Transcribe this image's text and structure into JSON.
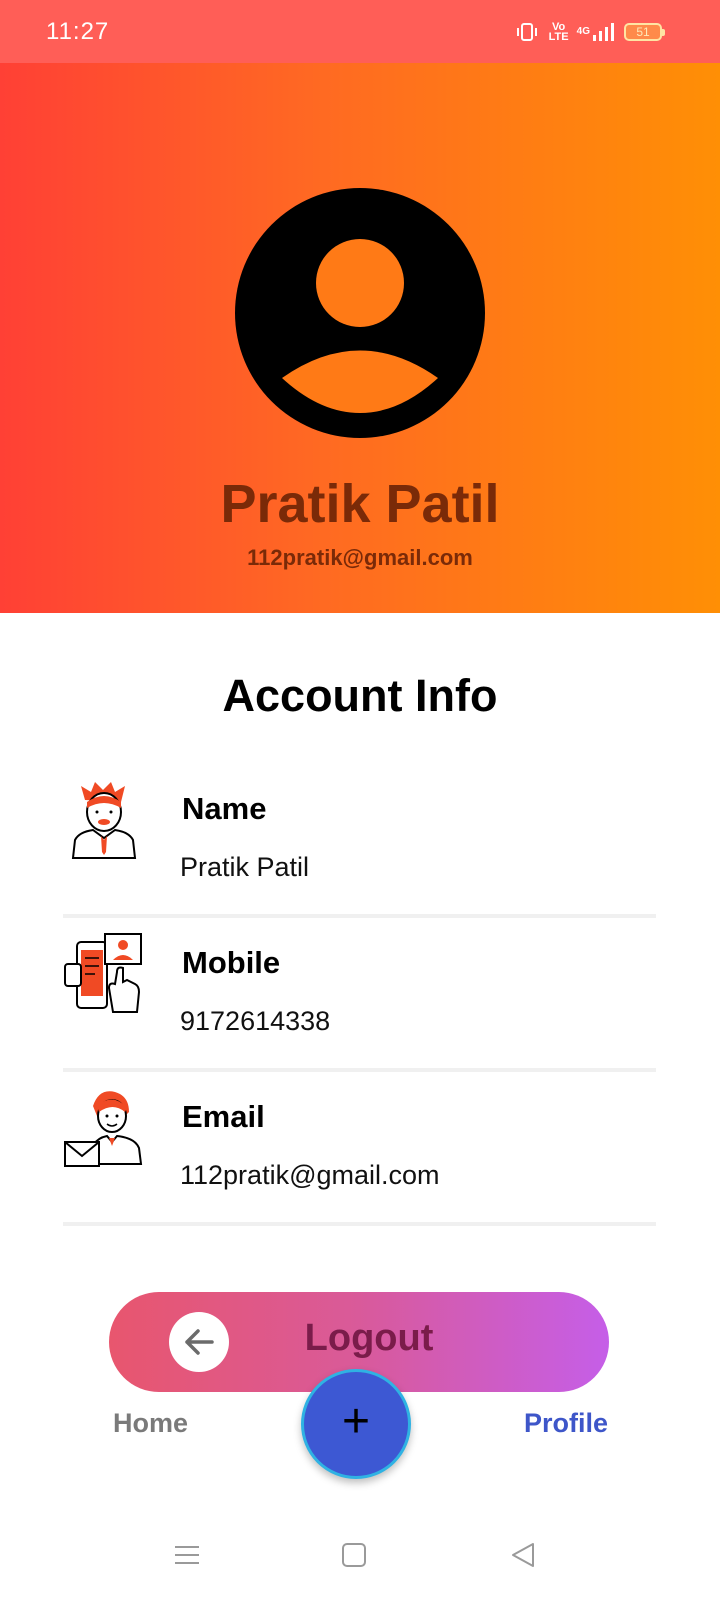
{
  "status_bar": {
    "time": "11:27",
    "volte_label": "Vo LTE",
    "network_label": "4G",
    "battery_level": "51"
  },
  "profile": {
    "name": "Pratik Patil",
    "email": "112pratik@gmail.com",
    "avatar_icon": "account-circle-icon"
  },
  "account_info": {
    "title": "Account Info",
    "rows": [
      {
        "label": "Name",
        "value": "Pratik Patil",
        "icon": "person-icon"
      },
      {
        "label": "Mobile",
        "value": "9172614338",
        "icon": "mobile-contact-icon"
      },
      {
        "label": "Email",
        "value": "112pratik@gmail.com",
        "icon": "email-person-icon"
      }
    ]
  },
  "logout": {
    "label": "Logout",
    "icon": "arrow-left-icon"
  },
  "bottom_nav": {
    "home_label": "Home",
    "profile_label": "Profile",
    "fab_icon": "plus-icon",
    "fab_label": "+"
  },
  "colors": {
    "header_gradient_start": "#ff4035",
    "header_gradient_end": "#ff8f05",
    "status_bar": "#ff5e57",
    "logout_gradient_start": "#e8566e",
    "logout_gradient_end": "#c55ee8",
    "fab": "#3d58d3",
    "active_nav": "#3e56c9"
  }
}
